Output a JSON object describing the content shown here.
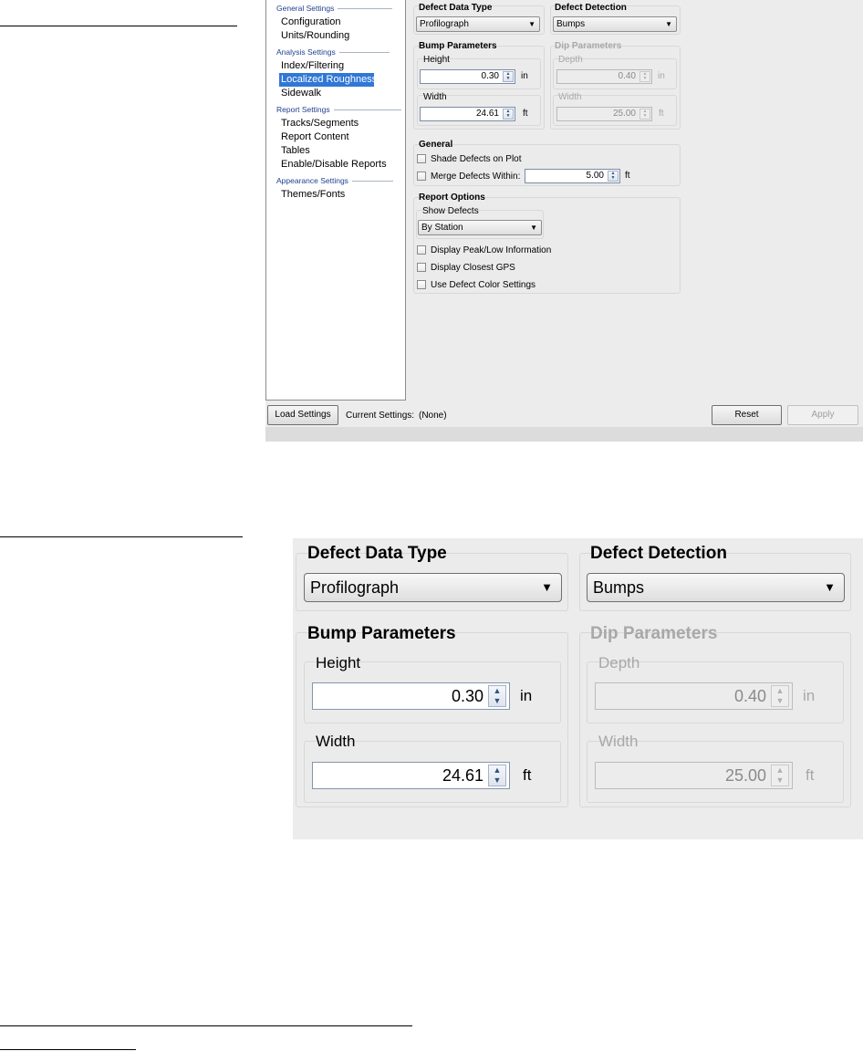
{
  "nav": {
    "sections": [
      {
        "title": "General Settings",
        "items": [
          "Configuration",
          "Units/Rounding"
        ]
      },
      {
        "title": "Analysis Settings",
        "items": [
          "Index/Filtering",
          "Localized Roughness",
          "Sidewalk"
        ]
      },
      {
        "title": "Report Settings",
        "items": [
          "Tracks/Segments",
          "Report Content",
          "Tables",
          "Enable/Disable Reports"
        ]
      },
      {
        "title": "Appearance Settings",
        "items": [
          "Themes/Fonts"
        ]
      }
    ],
    "selected_item": "Localized Roughness"
  },
  "defect_data_type": {
    "title": "Defect Data Type",
    "value": "Profilograph"
  },
  "defect_detection": {
    "title": "Defect Detection",
    "value": "Bumps"
  },
  "bump": {
    "title": "Bump Parameters",
    "height_label": "Height",
    "height_value": "0.30",
    "height_unit": "in",
    "width_label": "Width",
    "width_value": "24.61",
    "width_unit": "ft"
  },
  "dip": {
    "title": "Dip Parameters",
    "depth_label": "Depth",
    "depth_value": "0.40",
    "depth_unit": "in",
    "width_label": "Width",
    "width_value": "25.00",
    "width_unit": "ft"
  },
  "general": {
    "title": "General",
    "shade_label": "Shade Defects on Plot",
    "merge_label": "Merge Defects Within:",
    "merge_value": "5.00",
    "merge_unit": "ft"
  },
  "report_options": {
    "title": "Report Options",
    "show_label": "Show Defects",
    "show_value": "By Station",
    "peak_label": "Display Peak/Low Information",
    "gps_label": "Display Closest GPS",
    "color_label": "Use Defect Color Settings"
  },
  "bottom": {
    "load_label": "Load Settings",
    "current_label": "Current Settings:",
    "current_value": "(None)",
    "reset_label": "Reset",
    "apply_label": "Apply"
  },
  "icons": {
    "dropdown": "chevron-down-icon",
    "spin_up": "arrow-up-icon",
    "spin_down": "arrow-down-icon",
    "checkbox": "checkbox-icon"
  }
}
